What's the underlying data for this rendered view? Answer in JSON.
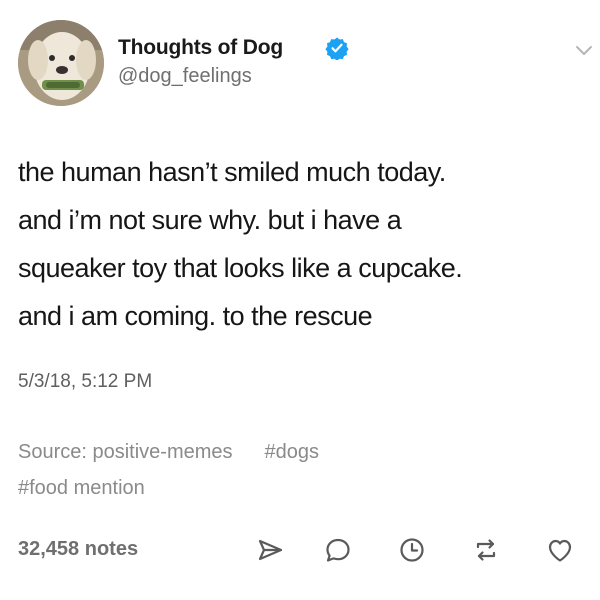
{
  "post": {
    "author_name": "Thoughts of Dog",
    "author_handle": "@dog_feelings",
    "body_lines": [
      "the human hasn’t smiled much today.",
      "and i’m not sure why. but i have a",
      "squeaker toy that looks like a cupcake.",
      "and i am coming. to the rescue"
    ],
    "timestamp": "5/3/18, 5:12 PM"
  },
  "tags": {
    "source": "Source: positive-memes",
    "items": [
      "#dogs",
      "#food mention"
    ]
  },
  "footer": {
    "notes": "32,458 notes",
    "actions": [
      "share-icon",
      "reply-icon",
      "queue-icon",
      "reblog-icon",
      "like-icon"
    ]
  },
  "icons": [
    "verified-badge-icon",
    "chevron-down-icon"
  ],
  "colors": {
    "verified_badge": "#1da1f2",
    "secondary_text": "#6f6f6f",
    "tag_text": "#8a8a8a",
    "icon_stroke": "#5a5a5a"
  }
}
